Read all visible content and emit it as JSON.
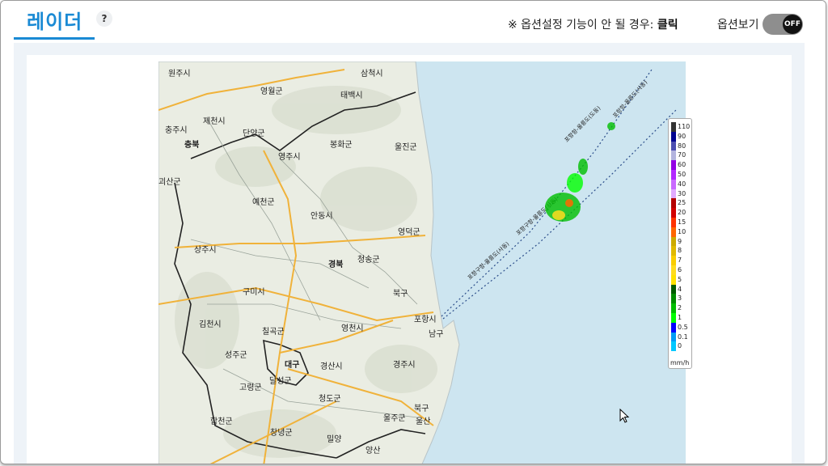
{
  "tabs": {
    "active_label": "레이더",
    "help_label": "?"
  },
  "notice": {
    "prefix": "※ 옵션설정 기능이 안 될 경우:",
    "action": "클릭"
  },
  "options": {
    "label": "옵션보기",
    "toggle_state": "OFF"
  },
  "map": {
    "places": [
      "원주시",
      "삼척시",
      "영월군",
      "태백시",
      "제천시",
      "충주시",
      "단양군",
      "봉화군",
      "울진군",
      "충북",
      "영주시",
      "괴산군",
      "예천군",
      "안동시",
      "영덕군",
      "상주시",
      "경북",
      "청송군",
      "구미시",
      "북구",
      "포항시",
      "남구",
      "김천시",
      "칠곡군",
      "영천시",
      "성주군",
      "대구",
      "경산시",
      "경주시",
      "고령군",
      "달성군",
      "청도군",
      "울주군",
      "합천군",
      "창녕군",
      "밀양",
      "양산",
      "북구",
      "울산"
    ],
    "route_labels": [
      "포항항-울릉도(사동)",
      "포항항-울릉도(도동)",
      "포항구항-울릉도(사동)",
      "포항구항-울릉도(사동)"
    ]
  },
  "legend": {
    "unit": "mm/h",
    "items": [
      {
        "value": "110",
        "color": "#333333"
      },
      {
        "value": "90",
        "color": "#000390"
      },
      {
        "value": "80",
        "color": "#4c4eb1"
      },
      {
        "value": "70",
        "color": "#b3b4de"
      },
      {
        "value": "60",
        "color": "#9300e4"
      },
      {
        "value": "50",
        "color": "#b229ff"
      },
      {
        "value": "40",
        "color": "#c969ff"
      },
      {
        "value": "30",
        "color": "#e0a9ff"
      },
      {
        "value": "25",
        "color": "#b40000"
      },
      {
        "value": "20",
        "color": "#d20000"
      },
      {
        "value": "15",
        "color": "#ff3200"
      },
      {
        "value": "10",
        "color": "#ff6600"
      },
      {
        "value": "9",
        "color": "#ccaa00"
      },
      {
        "value": "8",
        "color": "#e0b900"
      },
      {
        "value": "7",
        "color": "#f9cd00"
      },
      {
        "value": "6",
        "color": "#ffdc1f"
      },
      {
        "value": "5",
        "color": "#ffe100"
      },
      {
        "value": "4",
        "color": "#005a00"
      },
      {
        "value": "3",
        "color": "#008c00"
      },
      {
        "value": "2",
        "color": "#00be00"
      },
      {
        "value": "1",
        "color": "#00ff00"
      },
      {
        "value": "0.5",
        "color": "#0000ff"
      },
      {
        "value": "0.1",
        "color": "#009bf5"
      },
      {
        "value": "0",
        "color": "#00c8ff"
      }
    ]
  },
  "colors": {
    "accent": "#1a8ad4",
    "sea": "#cde5f0",
    "land": "#eef0e6"
  }
}
